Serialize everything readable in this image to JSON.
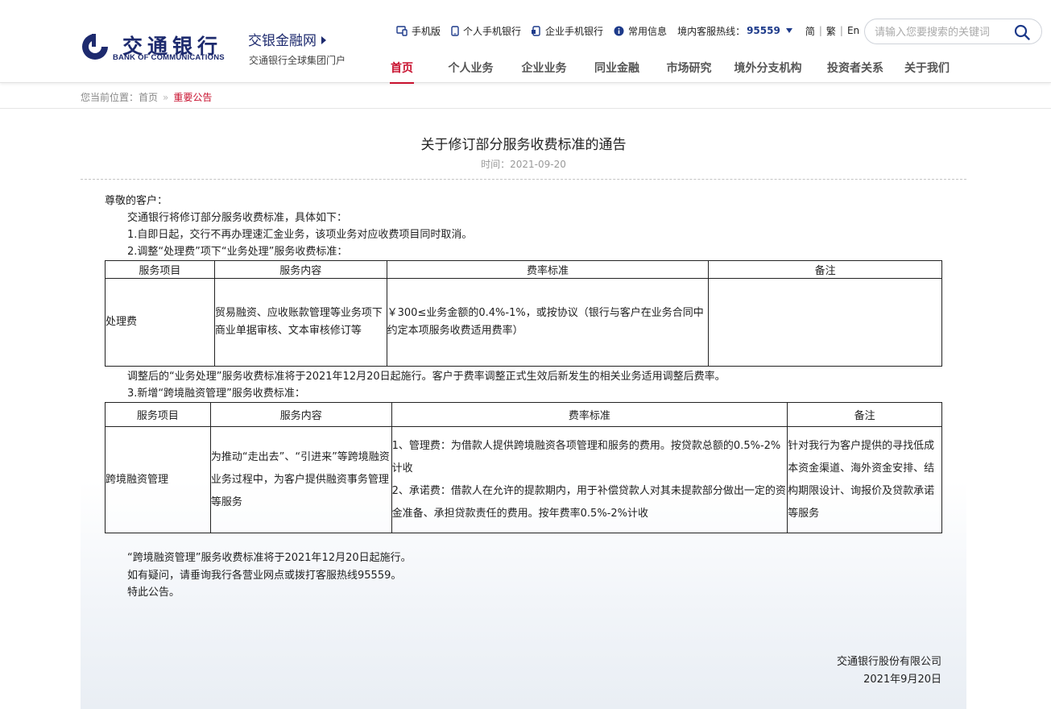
{
  "brand": {
    "logo_cn": "交通银行",
    "logo_en": "BANK OF COMMUNICATIONS",
    "site_name": "交银金融网",
    "tagline": "交通银行全球集团门户"
  },
  "toplinks": {
    "mobile": "手机版",
    "personal_app": "个人手机银行",
    "corporate_app": "企业手机银行",
    "info": "常用信息",
    "hotline_label": "境内客服热线：",
    "hotline_number": "95559",
    "lang_simplified": "简",
    "lang_traditional": "繁",
    "lang_en": "En"
  },
  "search": {
    "placeholder": "请输入您要搜索的关键词"
  },
  "nav": [
    "首页",
    "个人业务",
    "企业业务",
    "同业金融",
    "市场研究",
    "境外分支机构",
    "投资者关系",
    "关于我们"
  ],
  "breadcrumb": {
    "prefix": "您当前位置：",
    "home": "首页",
    "sep": "»",
    "current": "重要公告"
  },
  "article": {
    "title": "关于修订部分服务收费标准的通告",
    "date": "时间：2021-09-20",
    "greeting": "尊敬的客户：",
    "intro": "交通银行将修订部分服务收费标准，具体如下：",
    "item1": "1.自即日起，交行不再办理速汇金业务，该项业务对应收费项目同时取消。",
    "item2": "2.调整“处理费”项下“业务处理”服务收费标准：",
    "table1": {
      "headers": [
        "服务项目",
        "服务内容",
        "费率标准",
        "备注"
      ],
      "row": [
        "处理费",
        "贸易融资、应收账款管理等业务项下商业单据审核、文本审核修订等",
        "￥300≤业务金额的0.4%-1%，或按协议（银行与客户在业务合同中约定本项服务收费适用费率）",
        ""
      ]
    },
    "item2_note": "调整后的“业务处理”服务收费标准将于2021年12月20日起施行。客户于费率调整正式生效后新发生的相关业务适用调整后费率。",
    "item3": "3.新增“跨境融资管理”服务收费标准：",
    "table2": {
      "headers": [
        "服务项目",
        "服务内容",
        "费率标准",
        "备注"
      ],
      "row": {
        "item": "跨境融资管理",
        "content": "为推动“走出去”、“引进来”等跨境融资业务过程中，为客户提供融资事务管理等服务",
        "rate_line1": "1、管理费：为借款人提供跨境融资各项管理和服务的费用。按贷款总额的0.5%-2%计收",
        "rate_line2": "2、承诺费：借款人在允许的提款期内，用于补偿贷款人对其未提款部分做出一定的资金准备、承担贷款责任的费用。按年费率0.5%-2%计收",
        "remark": "针对我行为客户提供的寻找低成本资金渠道、海外资金安排、结构期限设计、询报价及贷款承诺等服务"
      }
    },
    "item3_note": "“跨境融资管理”服务收费标准将于2021年12月20日起施行。",
    "contact": "如有疑问，请垂询我行各营业网点或拨打客服热线95559。",
    "closing": "特此公告。",
    "signature_company": "交通银行股份有限公司",
    "signature_date": "2021年9月20日"
  },
  "colors": {
    "brand_blue": "#1d2a6e",
    "accent_red": "#c8102e"
  }
}
